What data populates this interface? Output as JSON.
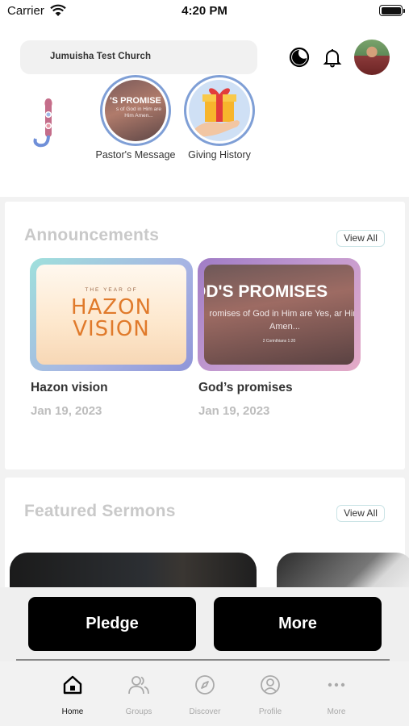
{
  "status_bar": {
    "carrier": "Carrier",
    "time": "4:20 PM"
  },
  "header": {
    "church_name": "Jumuisha Test Church"
  },
  "stories": [
    {
      "label": "Pastor's Message",
      "image_text": "'S PROMISE",
      "image_subtext": "s of God in Him are Him Amen..."
    },
    {
      "label": "Giving History"
    }
  ],
  "announcements": {
    "title": "Announcements",
    "view_all": "View All",
    "items": [
      {
        "title": "Hazon vision",
        "date": "Jan 19, 2023",
        "image_kicker": "THE YEAR OF",
        "image_title": "HAZON VISION"
      },
      {
        "title": "God’s promises",
        "date": "Jan 19, 2023",
        "image_title": "OD'S PROMISES",
        "image_body": "romises of God in Him are Yes, ar Him Amen...",
        "image_ref": "2 Corinthians 1:20"
      }
    ]
  },
  "featured_sermons": {
    "title": "Featured Sermons",
    "view_all": "View All"
  },
  "actions": {
    "pledge": "Pledge",
    "more": "More"
  },
  "tabs": [
    {
      "label": "Home",
      "icon": "home-icon",
      "active": true
    },
    {
      "label": "Groups",
      "icon": "groups-icon",
      "active": false
    },
    {
      "label": "Discover",
      "icon": "compass-icon",
      "active": false
    },
    {
      "label": "Profile",
      "icon": "profile-icon",
      "active": false
    },
    {
      "label": "More",
      "icon": "more-dots-icon",
      "active": false
    }
  ],
  "colors": {
    "story_ring": "#7f9fd6",
    "section_title": "#c9c9c9",
    "view_all_border": "#cbe4e6",
    "action_button": "#000000"
  }
}
